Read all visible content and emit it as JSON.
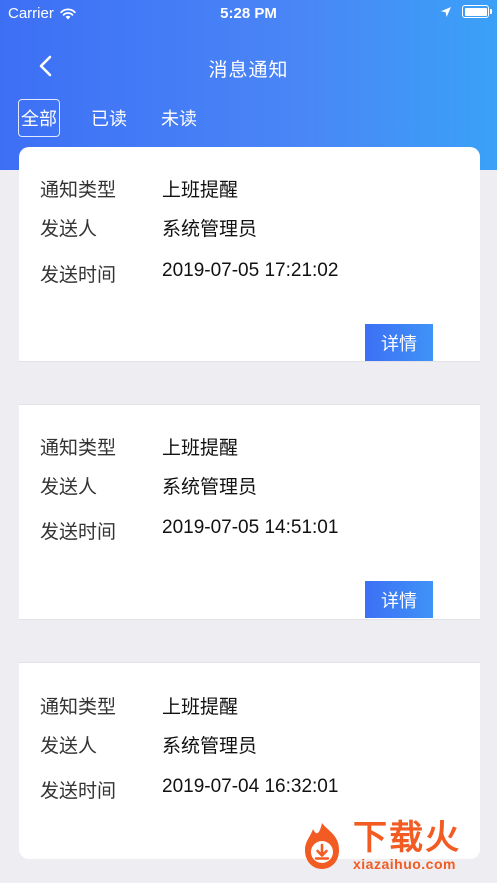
{
  "status_bar": {
    "carrier": "Carrier",
    "time": "5:28 PM"
  },
  "navbar": {
    "title": "消息通知"
  },
  "tabs": [
    {
      "label": "全部",
      "active": true
    },
    {
      "label": "已读",
      "active": false
    },
    {
      "label": "未读",
      "active": false
    }
  ],
  "labels": {
    "type": "通知类型",
    "sender": "发送人",
    "time": "发送时间",
    "detail_button": "详情"
  },
  "notifications": [
    {
      "type": "上班提醒",
      "sender": "系统管理员",
      "time": "2019-07-05 17:21:02"
    },
    {
      "type": "上班提醒",
      "sender": "系统管理员",
      "time": "2019-07-05 14:51:01"
    },
    {
      "type": "上班提醒",
      "sender": "系统管理员",
      "time": "2019-07-04 16:32:01"
    }
  ],
  "watermark": {
    "text": "下载火",
    "url": "xiazaihuo.com"
  },
  "colors": {
    "accent": "#3d6ff5",
    "accent_light": "#3aa1f7",
    "watermark": "#f25b22",
    "background": "#eeeef2"
  }
}
